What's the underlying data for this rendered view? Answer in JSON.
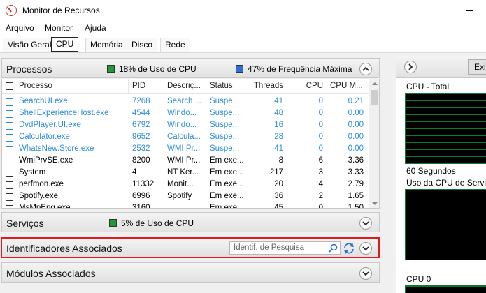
{
  "window": {
    "title": "Monitor de Recursos"
  },
  "menu": [
    "Arquivo",
    "Monitor",
    "Ajuda"
  ],
  "tabs": [
    "Visão Geral",
    "CPU",
    "Memória",
    "Disco",
    "Rede"
  ],
  "active_tab": "CPU",
  "processes": {
    "title": "Processos",
    "cpu_usage": "18% de Uso de CPU",
    "max_freq": "47% de Frequência Máxima",
    "cpu_usage_color": "#1f9a3a",
    "max_freq_color": "#2b6fd6",
    "columns": [
      "Processo",
      "PID",
      "Descriç...",
      "Status",
      "Threads",
      "CPU",
      "CPU M..."
    ],
    "rows": [
      {
        "name": "SearchUI.exe",
        "pid": "7268",
        "desc": "Search ...",
        "status": "Suspe...",
        "threads": "41",
        "cpu": "0",
        "cpum": "0.21",
        "suspended": true
      },
      {
        "name": "ShellExperienceHost.exe",
        "pid": "4544",
        "desc": "Windo...",
        "status": "Suspe...",
        "threads": "48",
        "cpu": "0",
        "cpum": "0.00",
        "suspended": true
      },
      {
        "name": "DvdPlayer.UI.exe",
        "pid": "6792",
        "desc": "Windo...",
        "status": "Suspe...",
        "threads": "16",
        "cpu": "0",
        "cpum": "0.00",
        "suspended": true
      },
      {
        "name": "Calculator.exe",
        "pid": "9652",
        "desc": "Calcula...",
        "status": "Suspe...",
        "threads": "28",
        "cpu": "0",
        "cpum": "0.00",
        "suspended": true
      },
      {
        "name": "WhatsNew.Store.exe",
        "pid": "2532",
        "desc": "WMI Pr...",
        "status": "Suspe...",
        "threads": "41",
        "cpu": "0",
        "cpum": "0.00",
        "suspended": true
      },
      {
        "name": "WmiPrvSE.exe",
        "pid": "8200",
        "desc": "WMI Pr...",
        "status": "Em exe...",
        "threads": "8",
        "cpu": "6",
        "cpum": "3.36",
        "suspended": false
      },
      {
        "name": "System",
        "pid": "4",
        "desc": "NT Ker...",
        "status": "Em exe...",
        "threads": "217",
        "cpu": "3",
        "cpum": "3.33",
        "suspended": false
      },
      {
        "name": "perfmon.exe",
        "pid": "11332",
        "desc": "Monit...",
        "status": "Em exe...",
        "threads": "20",
        "cpu": "4",
        "cpum": "2.79",
        "suspended": false
      },
      {
        "name": "Spotify.exe",
        "pid": "6996",
        "desc": "Spotify",
        "status": "Em exe...",
        "threads": "36",
        "cpu": "2",
        "cpum": "1.65",
        "suspended": false
      },
      {
        "name": "MsMpEng.exe",
        "pid": "3160",
        "desc": "",
        "status": "Em exe...",
        "threads": "45",
        "cpu": "0",
        "cpum": "1.50",
        "suspended": false
      }
    ]
  },
  "services": {
    "title": "Serviços",
    "cpu_usage": "5% de Uso de CPU"
  },
  "handles": {
    "title": "Identificadores Associados",
    "search_placeholder": "Identif. de Pesquisa"
  },
  "modules": {
    "title": "Módulos Associados"
  },
  "right_panel": {
    "button": "Exibir",
    "graph1_title": "CPU - Total",
    "graph1_footer": "60 Segundos",
    "graph2_title": "Uso da CPU de Serviço",
    "graph3_title": "CPU 0"
  },
  "colors": {
    "suspended_text": "#2d8ed6",
    "highlight_border": "#e0191f",
    "graph_grid": "#0a7a2a"
  }
}
